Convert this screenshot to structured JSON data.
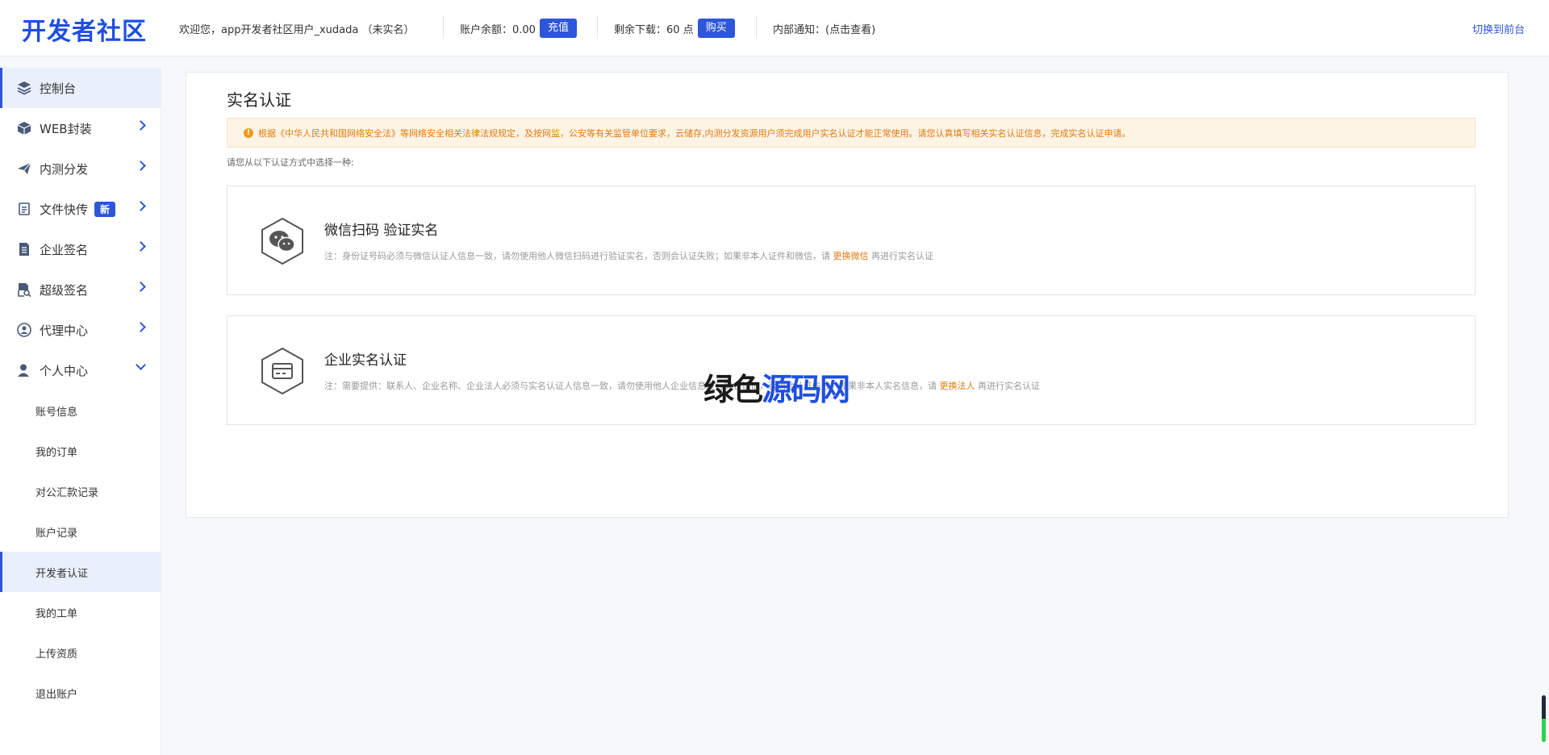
{
  "header": {
    "logo": "开发者社区",
    "welcome": "欢迎您，app开发者社区用户_xudada （未实名）",
    "balance_label": "账户余额：0.00",
    "recharge_btn": "充值",
    "downloads_label": "剩余下载：60 点",
    "buy_btn": "购买",
    "notice": "内部通知：(点击查看)",
    "switch_front": "切换到前台"
  },
  "sidebar": {
    "items": [
      {
        "label": "控制台",
        "icon": "layers-icon"
      },
      {
        "label": "WEB封装",
        "icon": "box-icon"
      },
      {
        "label": "内测分发",
        "icon": "paper-plane-icon"
      },
      {
        "label": "文件快传",
        "icon": "file-transfer-icon",
        "badge": "新"
      },
      {
        "label": "企业签名",
        "icon": "document-icon"
      },
      {
        "label": "超级签名",
        "icon": "document-search-icon"
      },
      {
        "label": "代理中心",
        "icon": "agent-icon"
      },
      {
        "label": "个人中心",
        "icon": "user-icon"
      }
    ],
    "sub_items": [
      "账号信息",
      "我的订单",
      "对公汇款记录",
      "账户记录",
      "开发者认证",
      "我的工单",
      "上传资质",
      "退出账户"
    ]
  },
  "main": {
    "title": "实名认证",
    "alert": "根据《中华人民共和国网络安全法》等网络安全相关法律法规规定，及按网监，公安等有关监管单位要求，云储存,内测分发资源用户须完成用户实名认证才能正常使用。请您认真填写相关实名认证信息，完成实名认证申请。",
    "choose_tip": "请您从以下认证方式中选择一种:",
    "cards": [
      {
        "title": "微信扫码 验证实名",
        "note_pre": "注：身份证号码必须与微信认证人信息一致，请勿使用他人微信扫码进行验证实名，否则会认证失败；如果非本人证件和微信，请",
        "note_link": "更换微信",
        "note_post": "再进行实名认证"
      },
      {
        "title": "企业实名认证",
        "note_pre": "注：需要提供：联系人、企业名称、企业法人必须与实名认证人信息一致，请勿使用他人企业信息进行实名认证，否则会认证失败；如果非本人实名信息，请",
        "note_link": "更换法人",
        "note_post": "再进行实名认证"
      }
    ]
  },
  "watermark": {
    "part1": "绿色",
    "part2": "源码网"
  },
  "colors": {
    "accent": "#2d56d8",
    "warning": "#e07a10",
    "warning_bg": "#fdf4e6"
  }
}
